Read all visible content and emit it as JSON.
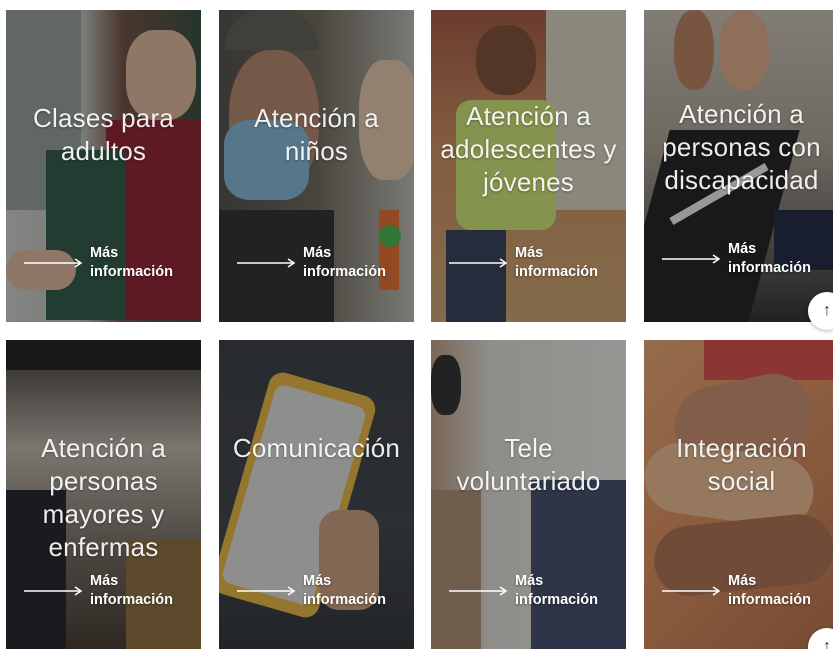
{
  "cards": [
    {
      "title": "Clases para\nadultos",
      "more": "Más\ninformación"
    },
    {
      "title": "Atención a\nniños",
      "more": "Más\ninformación"
    },
    {
      "title": "Atención a\nadolescentes y\njóvenes",
      "more": "Más\ninformación"
    },
    {
      "title": "Atención a\npersonas con\ndiscapacidad",
      "more": "Más\ninformación"
    },
    {
      "title": "Atención a\npersonas\nmayores y\nenfermas",
      "more": "Más\ninformación"
    },
    {
      "title": "Comunicación",
      "more": "Más\ninformación"
    },
    {
      "title": "Tele\nvoluntariado",
      "more": "Más\ninformación"
    },
    {
      "title": "Integración\nsocial",
      "more": "Más\ninformación"
    }
  ],
  "scroll_top": {
    "icon": "arrow-up-icon",
    "glyph": "↑"
  },
  "colors": {
    "overlay": "#141414",
    "text": "#ffffff"
  }
}
